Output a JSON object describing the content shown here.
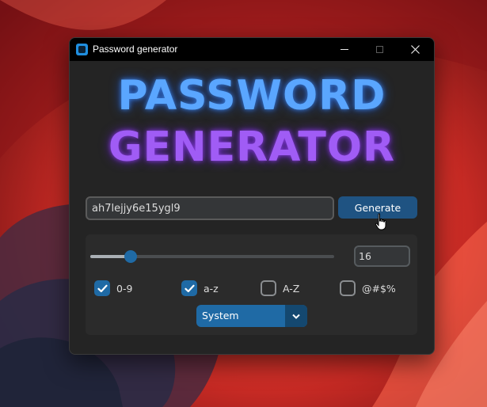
{
  "window": {
    "title": "Password generator",
    "controls": [
      "minimize-icon",
      "maximize-icon",
      "close-icon"
    ]
  },
  "logo": {
    "line1": "PASSWORD",
    "line2": "GENERATOR",
    "colors": {
      "line1": "#5aa6ff",
      "line2": "#a05cf5"
    }
  },
  "password": {
    "value": "ah7lejjy6e15ygl9"
  },
  "generate": {
    "label": "Generate"
  },
  "length": {
    "value": "16",
    "slider_fraction": 0.166
  },
  "options": [
    {
      "label": "0-9",
      "checked": true
    },
    {
      "label": "a-z",
      "checked": true
    },
    {
      "label": "A-Z",
      "checked": false
    },
    {
      "label": "@#$%",
      "checked": false
    }
  ],
  "appearance": {
    "selected": "System"
  },
  "colors": {
    "accent": "#1f6aa5",
    "window_bg": "#242424",
    "frame_bg": "#2b2b2b",
    "text": "#dcdcdc"
  }
}
